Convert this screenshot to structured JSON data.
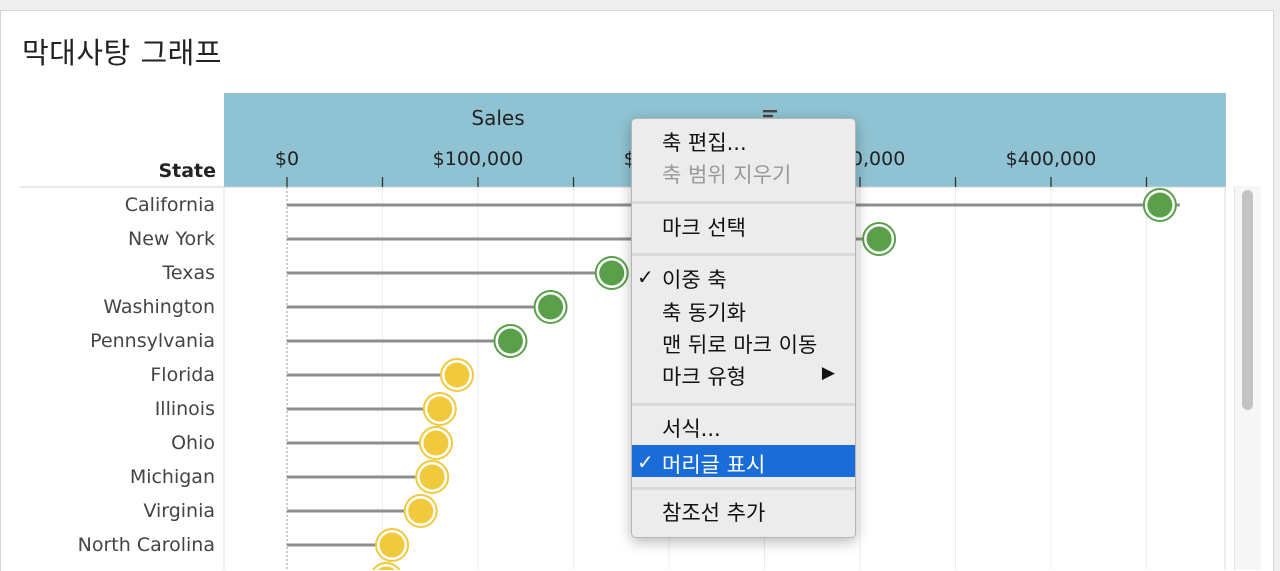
{
  "title": "막대사탕 그래프",
  "header": {
    "field_label": "Sales",
    "sort_icon": "sort-icon"
  },
  "row_header": "State",
  "colors": {
    "header_band": "#8fc3d3",
    "high": "#5aa04a",
    "mid": "#f0c93c",
    "stem": "#8e8e8e",
    "highlight": "#1a6dd8"
  },
  "axis": {
    "min": 0,
    "max": 470000,
    "ticks": [
      {
        "value": 0,
        "label": "$0"
      },
      {
        "value": 100000,
        "label": "$100,000"
      },
      {
        "value": 200000,
        "label": "$200,000"
      },
      {
        "value": 300000,
        "label": "$300,000"
      },
      {
        "value": 400000,
        "label": "$400,000"
      }
    ]
  },
  "chart_data": {
    "type": "scatter",
    "xlabel": "Sales",
    "ylabel": "State",
    "categories": [
      "California",
      "New York",
      "Texas",
      "Washington",
      "Pennsylvania",
      "Florida",
      "Illinois",
      "Ohio",
      "Michigan",
      "Virginia",
      "North Carolina"
    ],
    "values": [
      457000,
      310000,
      170000,
      138000,
      117000,
      89000,
      80000,
      78000,
      76000,
      70000,
      55000
    ],
    "groups": [
      "high",
      "high",
      "high",
      "high",
      "high",
      "mid",
      "mid",
      "mid",
      "mid",
      "mid",
      "mid"
    ],
    "xlim": [
      0,
      470000
    ]
  },
  "menu": {
    "items": [
      {
        "label": "축 편집...",
        "checked": false,
        "disabled": false,
        "submenu": false,
        "highlighted": false
      },
      {
        "label": "축 범위 지우기",
        "checked": false,
        "disabled": true,
        "submenu": false,
        "highlighted": false
      },
      {
        "label": "마크 선택",
        "checked": false,
        "disabled": false,
        "submenu": false,
        "highlighted": false
      },
      {
        "label": "이중 축",
        "checked": true,
        "disabled": false,
        "submenu": false,
        "highlighted": false
      },
      {
        "label": "축 동기화",
        "checked": false,
        "disabled": false,
        "submenu": false,
        "highlighted": false
      },
      {
        "label": "맨 뒤로 마크 이동",
        "checked": false,
        "disabled": false,
        "submenu": false,
        "highlighted": false
      },
      {
        "label": "마크 유형",
        "checked": false,
        "disabled": false,
        "submenu": true,
        "highlighted": false
      },
      {
        "label": "서식...",
        "checked": false,
        "disabled": false,
        "submenu": false,
        "highlighted": false
      },
      {
        "label": "머리글 표시",
        "checked": true,
        "disabled": false,
        "submenu": false,
        "highlighted": true
      },
      {
        "label": "참조선 추가",
        "checked": false,
        "disabled": false,
        "submenu": false,
        "highlighted": false
      }
    ]
  }
}
